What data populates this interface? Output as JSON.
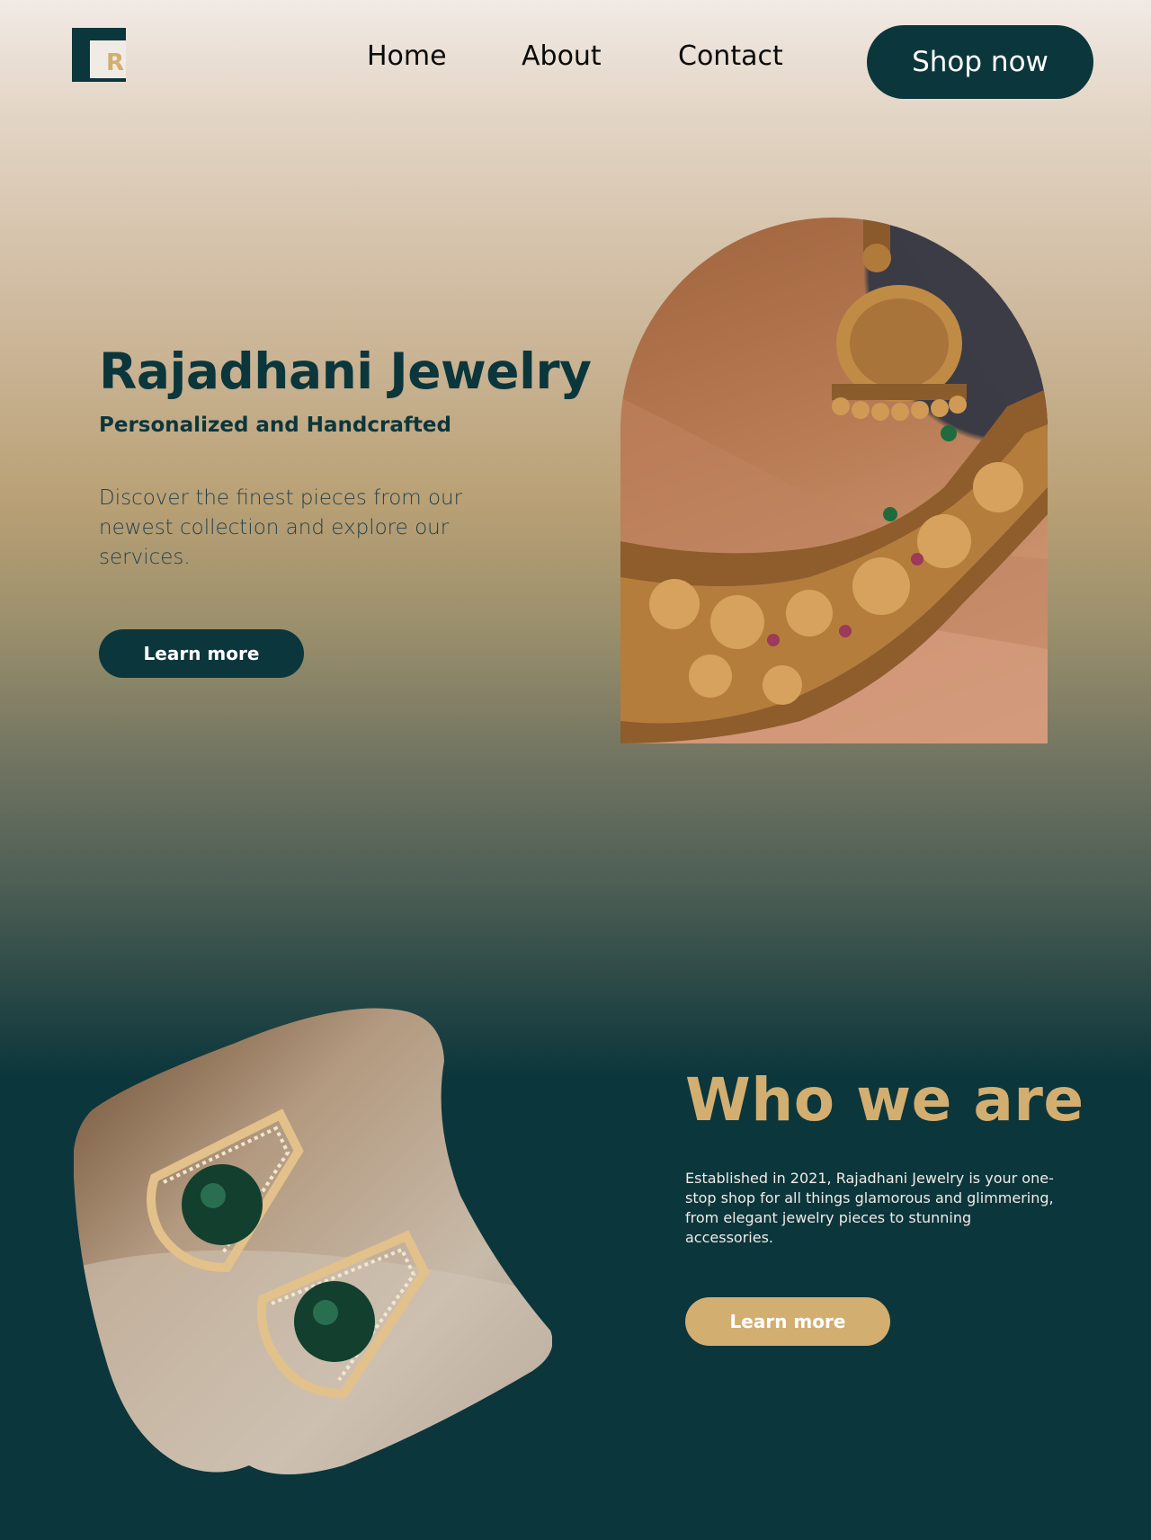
{
  "brand": {
    "logo_letter": "R",
    "colors": {
      "primary": "#0b363c",
      "accent": "#d3ae71",
      "light": "#f1ebe5"
    }
  },
  "nav": {
    "items": [
      {
        "label": "Home"
      },
      {
        "label": "About"
      },
      {
        "label": "Contact"
      }
    ],
    "cta_label": "Shop now"
  },
  "hero": {
    "title": "Rajadhani Jewelry",
    "subtitle": "Personalized and Handcrafted",
    "description": "Discover the finest pieces from our newest collection and explore our services.",
    "button_label": "Learn more",
    "image_icon": "necklace-photo"
  },
  "about": {
    "title": "Who we are",
    "description": "Established in 2021, Rajadhani Jewelry is your one-stop shop for all things glamorous and glimmering, from elegant jewelry pieces to stunning accessories.",
    "button_label": "Learn more",
    "image_icon": "earrings-photo"
  }
}
